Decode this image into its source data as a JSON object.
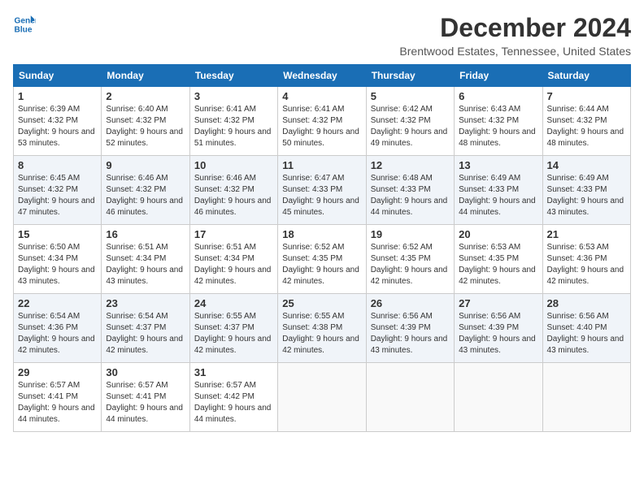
{
  "header": {
    "logo_line1": "General",
    "logo_line2": "Blue",
    "title": "December 2024",
    "subtitle": "Brentwood Estates, Tennessee, United States"
  },
  "days_of_week": [
    "Sunday",
    "Monday",
    "Tuesday",
    "Wednesday",
    "Thursday",
    "Friday",
    "Saturday"
  ],
  "weeks": [
    [
      {
        "day": "1",
        "sunrise": "6:39 AM",
        "sunset": "4:32 PM",
        "daylight": "9 hours and 53 minutes."
      },
      {
        "day": "2",
        "sunrise": "6:40 AM",
        "sunset": "4:32 PM",
        "daylight": "9 hours and 52 minutes."
      },
      {
        "day": "3",
        "sunrise": "6:41 AM",
        "sunset": "4:32 PM",
        "daylight": "9 hours and 51 minutes."
      },
      {
        "day": "4",
        "sunrise": "6:41 AM",
        "sunset": "4:32 PM",
        "daylight": "9 hours and 50 minutes."
      },
      {
        "day": "5",
        "sunrise": "6:42 AM",
        "sunset": "4:32 PM",
        "daylight": "9 hours and 49 minutes."
      },
      {
        "day": "6",
        "sunrise": "6:43 AM",
        "sunset": "4:32 PM",
        "daylight": "9 hours and 48 minutes."
      },
      {
        "day": "7",
        "sunrise": "6:44 AM",
        "sunset": "4:32 PM",
        "daylight": "9 hours and 48 minutes."
      }
    ],
    [
      {
        "day": "8",
        "sunrise": "6:45 AM",
        "sunset": "4:32 PM",
        "daylight": "9 hours and 47 minutes."
      },
      {
        "day": "9",
        "sunrise": "6:46 AM",
        "sunset": "4:32 PM",
        "daylight": "9 hours and 46 minutes."
      },
      {
        "day": "10",
        "sunrise": "6:46 AM",
        "sunset": "4:32 PM",
        "daylight": "9 hours and 46 minutes."
      },
      {
        "day": "11",
        "sunrise": "6:47 AM",
        "sunset": "4:33 PM",
        "daylight": "9 hours and 45 minutes."
      },
      {
        "day": "12",
        "sunrise": "6:48 AM",
        "sunset": "4:33 PM",
        "daylight": "9 hours and 44 minutes."
      },
      {
        "day": "13",
        "sunrise": "6:49 AM",
        "sunset": "4:33 PM",
        "daylight": "9 hours and 44 minutes."
      },
      {
        "day": "14",
        "sunrise": "6:49 AM",
        "sunset": "4:33 PM",
        "daylight": "9 hours and 43 minutes."
      }
    ],
    [
      {
        "day": "15",
        "sunrise": "6:50 AM",
        "sunset": "4:34 PM",
        "daylight": "9 hours and 43 minutes."
      },
      {
        "day": "16",
        "sunrise": "6:51 AM",
        "sunset": "4:34 PM",
        "daylight": "9 hours and 43 minutes."
      },
      {
        "day": "17",
        "sunrise": "6:51 AM",
        "sunset": "4:34 PM",
        "daylight": "9 hours and 42 minutes."
      },
      {
        "day": "18",
        "sunrise": "6:52 AM",
        "sunset": "4:35 PM",
        "daylight": "9 hours and 42 minutes."
      },
      {
        "day": "19",
        "sunrise": "6:52 AM",
        "sunset": "4:35 PM",
        "daylight": "9 hours and 42 minutes."
      },
      {
        "day": "20",
        "sunrise": "6:53 AM",
        "sunset": "4:35 PM",
        "daylight": "9 hours and 42 minutes."
      },
      {
        "day": "21",
        "sunrise": "6:53 AM",
        "sunset": "4:36 PM",
        "daylight": "9 hours and 42 minutes."
      }
    ],
    [
      {
        "day": "22",
        "sunrise": "6:54 AM",
        "sunset": "4:36 PM",
        "daylight": "9 hours and 42 minutes."
      },
      {
        "day": "23",
        "sunrise": "6:54 AM",
        "sunset": "4:37 PM",
        "daylight": "9 hours and 42 minutes."
      },
      {
        "day": "24",
        "sunrise": "6:55 AM",
        "sunset": "4:37 PM",
        "daylight": "9 hours and 42 minutes."
      },
      {
        "day": "25",
        "sunrise": "6:55 AM",
        "sunset": "4:38 PM",
        "daylight": "9 hours and 42 minutes."
      },
      {
        "day": "26",
        "sunrise": "6:56 AM",
        "sunset": "4:39 PM",
        "daylight": "9 hours and 43 minutes."
      },
      {
        "day": "27",
        "sunrise": "6:56 AM",
        "sunset": "4:39 PM",
        "daylight": "9 hours and 43 minutes."
      },
      {
        "day": "28",
        "sunrise": "6:56 AM",
        "sunset": "4:40 PM",
        "daylight": "9 hours and 43 minutes."
      }
    ],
    [
      {
        "day": "29",
        "sunrise": "6:57 AM",
        "sunset": "4:41 PM",
        "daylight": "9 hours and 44 minutes."
      },
      {
        "day": "30",
        "sunrise": "6:57 AM",
        "sunset": "4:41 PM",
        "daylight": "9 hours and 44 minutes."
      },
      {
        "day": "31",
        "sunrise": "6:57 AM",
        "sunset": "4:42 PM",
        "daylight": "9 hours and 44 minutes."
      },
      null,
      null,
      null,
      null
    ]
  ]
}
